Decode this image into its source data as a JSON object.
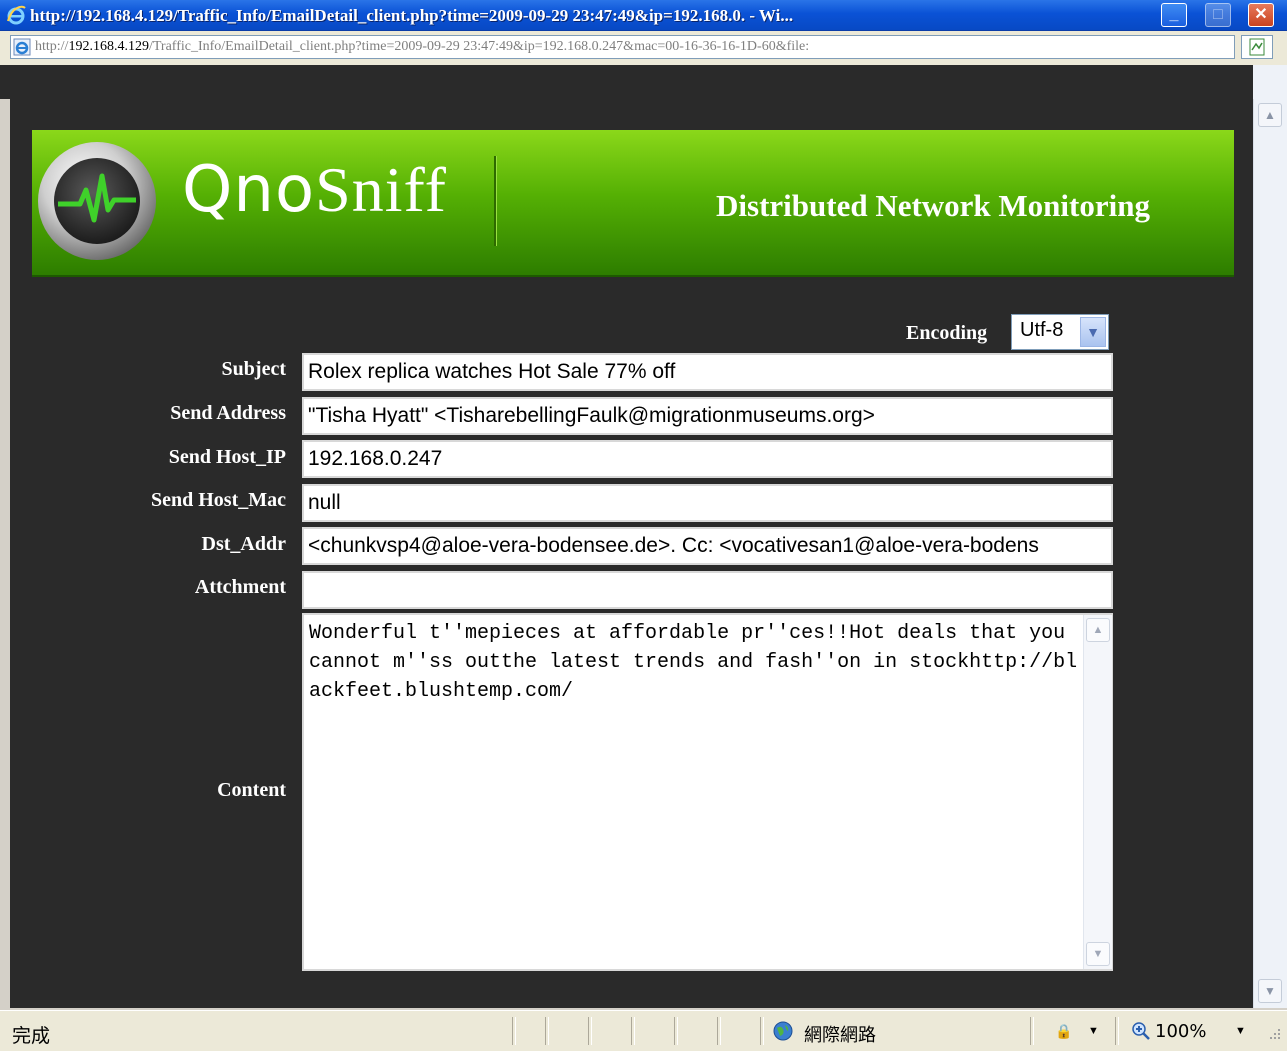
{
  "window": {
    "title": "http://192.168.4.129/Traffic_Info/EmailDetail_client.php?time=2009-09-29 23:47:49&ip=192.168.0. - Wi...",
    "min_glyph": "_",
    "max_glyph": "□",
    "close_glyph": "✕"
  },
  "address_bar": {
    "scheme": "http://",
    "host": "192.168.4.129",
    "path": "/Traffic_Info/EmailDetail_client.php?time=2009-09-29 23:47:49&ip=192.168.0.247&mac=00-16-36-16-1D-60&file:"
  },
  "banner": {
    "brand_prefix": "Qno",
    "brand_suffix": "Sniff",
    "tagline": "Distributed Network Monitoring",
    "logo_icon": "heartbeat-monitor-icon"
  },
  "form": {
    "encoding_label": "Encoding",
    "encoding_value": "Utf-8",
    "fields": {
      "subject": {
        "label": "Subject",
        "value": "Rolex replica watches Hot Sale 77% off"
      },
      "send_address": {
        "label": "Send Address",
        "value": "\"Tisha Hyatt\" <TisharebellingFaulk@migrationmuseums.org>"
      },
      "send_host_ip": {
        "label": "Send Host_IP",
        "value": "192.168.0.247"
      },
      "send_host_mac": {
        "label": "Send Host_Mac",
        "value": "null"
      },
      "dst_addr": {
        "label": "Dst_Addr",
        "value": "<chunkvsp4@aloe-vera-bodensee.de>. Cc: <vocativesan1@aloe-vera-bodens"
      },
      "attachment": {
        "label": "Attchment",
        "value": ""
      },
      "content": {
        "label": "Content",
        "value": "Wonderful t''mepieces at affordable pr''ces!!Hot deals that you cannot m''ss outthe latest trends and fash''on in stockhttp://blackfeet.blushtemp.com/"
      }
    }
  },
  "status_bar": {
    "status": "完成",
    "zone": "網際網路",
    "zoom": "100%"
  },
  "colors": {
    "page_bg": "#2a2a2a",
    "banner_green": "#55b004",
    "titlebar_blue": "#0a52d6"
  }
}
